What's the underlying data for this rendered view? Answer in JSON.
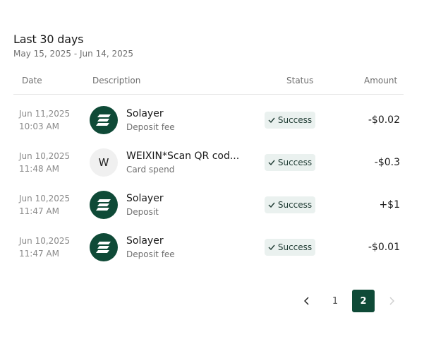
{
  "header": {
    "title": "Last 30 days",
    "date_range": "May 15, 2025 - Jun 14, 2025"
  },
  "table": {
    "columns": [
      "Date",
      "Description",
      "Status",
      "Amount"
    ],
    "rows": [
      {
        "date": "Jun 11,2025",
        "time": "10:03 AM",
        "name": "Solayer",
        "type": "Deposit fee",
        "icon": "solayer-logo-icon",
        "status": "Success",
        "amount": "-$0.02"
      },
      {
        "date": "Jun 10,2025",
        "time": "11:48 AM",
        "name": "WEIXIN*Scan QR cod...",
        "type": "Card spend",
        "avatar_letter": "W",
        "status": "Success",
        "amount": "-$0.3"
      },
      {
        "date": "Jun 10,2025",
        "time": "11:47 AM",
        "name": "Solayer",
        "type": "Deposit",
        "icon": "solayer-logo-icon",
        "status": "Success",
        "amount": "+$1"
      },
      {
        "date": "Jun 10,2025",
        "time": "11:47 AM",
        "name": "Solayer",
        "type": "Deposit fee",
        "icon": "solayer-logo-icon",
        "status": "Success",
        "amount": "-$0.01"
      }
    ]
  },
  "pagination": {
    "pages": [
      "1",
      "2"
    ],
    "current": "2",
    "prev_icon": "chevron-left-icon",
    "next_icon": "chevron-right-icon"
  },
  "colors": {
    "brand": "#0f4a37",
    "badge_bg": "#eaf1ef"
  }
}
